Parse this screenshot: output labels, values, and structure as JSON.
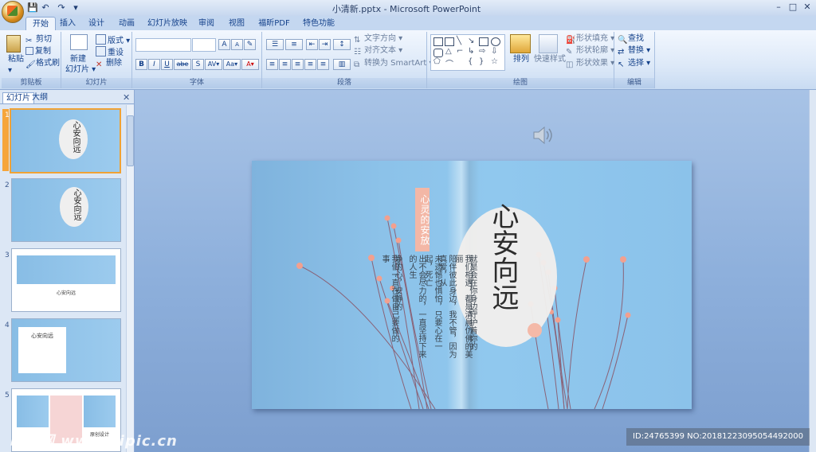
{
  "window": {
    "title": "小清新.pptx - Microsoft PowerPoint"
  },
  "quick_access": {
    "save": "💾",
    "undo": "↶",
    "redo": "↷",
    "customize": "▾"
  },
  "tabs": [
    "开始",
    "插入",
    "设计",
    "动画",
    "幻灯片放映",
    "审阅",
    "视图",
    "福昕PDF",
    "特色功能"
  ],
  "active_tab": "开始",
  "ribbon": {
    "clipboard": {
      "paste": "粘贴",
      "cut": "剪切",
      "copy": "复制",
      "format_painter": "格式刷",
      "label": "剪贴板"
    },
    "slides": {
      "new_slide": "新建",
      "new_slide_2": "幻灯片 ▾",
      "layout": "版式 ▾",
      "reset": "重设",
      "delete": "删除",
      "label": "幻灯片"
    },
    "font": {
      "label": "字体",
      "buttons": [
        "B",
        "I",
        "U",
        "abe",
        "S",
        "AV▾",
        "Aa▾",
        "A▾"
      ],
      "grow": "A",
      "shrink": "A"
    },
    "paragraph": {
      "text_direction": "文字方向 ▾",
      "align_text": "对齐文本 ▾",
      "smartart": "转换为 SmartArt ▾",
      "label": "段落"
    },
    "drawing": {
      "arrange": "排列",
      "quick_styles": "快速样式",
      "shape_fill": "形状填充 ▾",
      "shape_outline": "形状轮廓 ▾",
      "shape_effects": "形状效果 ▾",
      "label": "绘图"
    },
    "editing": {
      "find": "查找",
      "replace": "替换 ▾",
      "select": "选择 ▾",
      "label": "编辑"
    }
  },
  "panel": {
    "tab_slides": "幻灯片",
    "tab_outline": "大纲",
    "close": "✕"
  },
  "thumbnails": [
    {
      "num": "1",
      "title": "心安向远"
    },
    {
      "num": "2",
      "title": "心安向远"
    },
    {
      "num": "3",
      "title": "心安向远"
    },
    {
      "num": "4",
      "title": "心安向远"
    },
    {
      "num": "5",
      "title": "原创设计"
    }
  ],
  "slide": {
    "title": "心安向远",
    "pink_label": "心灵的安放",
    "columns": [
      "净的心，安静的",
      "出不会尽力的，一直坚持下来的人生",
      "未遗憾也惧怕，只要心在一起，死亡",
      "陪伴彼此身边，我不管，因为真爱，从",
      "我们相遇，都是清晨仿佛的美丽",
      "就是会在你身边守护着你的",
      "我们一直在做自己要做的事"
    ]
  },
  "watermark": "昵享网 www.nipic.cn",
  "image_id": "ID:24765399 NO:20181223095054492000"
}
